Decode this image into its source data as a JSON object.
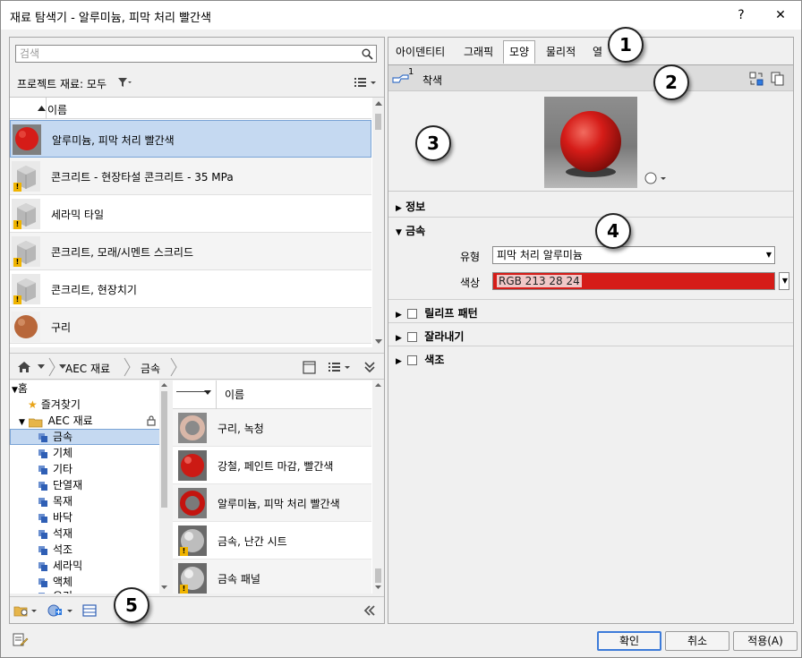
{
  "window": {
    "title": "재료 탐색기 - 알루미늄, 피막 처리 빨간색",
    "help_label": "?",
    "close_label": "✕"
  },
  "search": {
    "placeholder": "검색"
  },
  "project": {
    "label": "프로젝트 재료: 모두",
    "column_header": "이름",
    "materials": [
      {
        "name": "알루미늄, 피막 처리 빨간색",
        "thumb": "red-sphere",
        "selected": true,
        "warning": false
      },
      {
        "name": "콘크리트 - 현장타설 콘크리트 - 35 MPa",
        "thumb": "concrete-cube",
        "selected": false,
        "warning": true
      },
      {
        "name": "세라믹 타일",
        "thumb": "concrete-cube",
        "selected": false,
        "warning": true
      },
      {
        "name": "콘크리트, 모래/시멘트 스크리드",
        "thumb": "concrete-cube",
        "selected": false,
        "warning": true
      },
      {
        "name": "콘크리트, 현장치기",
        "thumb": "concrete-cube",
        "selected": false,
        "warning": true
      },
      {
        "name": "구리",
        "thumb": "copper-sphere",
        "selected": false,
        "warning": false
      }
    ]
  },
  "library": {
    "breadcrumb": [
      "AEC 재료",
      "금속"
    ],
    "tree": [
      {
        "label": "홈",
        "level": 0,
        "icon": "expand-arrow"
      },
      {
        "label": "즐겨찾기",
        "level": 1,
        "icon": "star-icon"
      },
      {
        "label": "AEC 재료",
        "level": 1,
        "icon": "folder-icon"
      },
      {
        "label": "금속",
        "level": 2,
        "icon": "category-icon",
        "selected": true
      },
      {
        "label": "기체",
        "level": 2,
        "icon": "category-icon"
      },
      {
        "label": "기타",
        "level": 2,
        "icon": "category-icon"
      },
      {
        "label": "단열재",
        "level": 2,
        "icon": "category-icon"
      },
      {
        "label": "목재",
        "level": 2,
        "icon": "category-icon"
      },
      {
        "label": "바닥",
        "level": 2,
        "icon": "category-icon"
      },
      {
        "label": "석재",
        "level": 2,
        "icon": "category-icon"
      },
      {
        "label": "석조",
        "level": 2,
        "icon": "category-icon"
      },
      {
        "label": "세라믹",
        "level": 2,
        "icon": "category-icon"
      },
      {
        "label": "액체",
        "level": 2,
        "icon": "category-icon"
      },
      {
        "label": "유리",
        "level": 2,
        "icon": "category-icon"
      }
    ],
    "column_header": "이름",
    "items": [
      {
        "name": "구리, 녹청",
        "thumb": "copper-ring"
      },
      {
        "name": "강철, 페인트 마감, 빨간색",
        "thumb": "red-sphere"
      },
      {
        "name": "알루미늄, 피막 처리 빨간색",
        "thumb": "red-ring"
      },
      {
        "name": "금속, 난간 시트",
        "thumb": "steel-sphere"
      },
      {
        "name": "금속 패널",
        "thumb": "steel-sphere"
      }
    ]
  },
  "tabs": [
    "아이덴티티",
    "그래픽",
    "모양",
    "물리적",
    "열"
  ],
  "active_tab": "모양",
  "asset": {
    "count": "1",
    "name": "착색"
  },
  "sections": {
    "info": "정보",
    "metal": "금속",
    "relief": "릴리프 패턴",
    "cutout": "잘라내기",
    "tint": "색조"
  },
  "metal": {
    "type_label": "유형",
    "type_value": "피막 처리 알루미늄",
    "color_label": "색상",
    "color_value": "RGB 213 28 24",
    "color_hex": "#d51c18"
  },
  "buttons": {
    "ok": "확인",
    "cancel": "취소",
    "apply": "적용(A)"
  },
  "callouts": [
    "1",
    "2",
    "3",
    "4",
    "5"
  ]
}
